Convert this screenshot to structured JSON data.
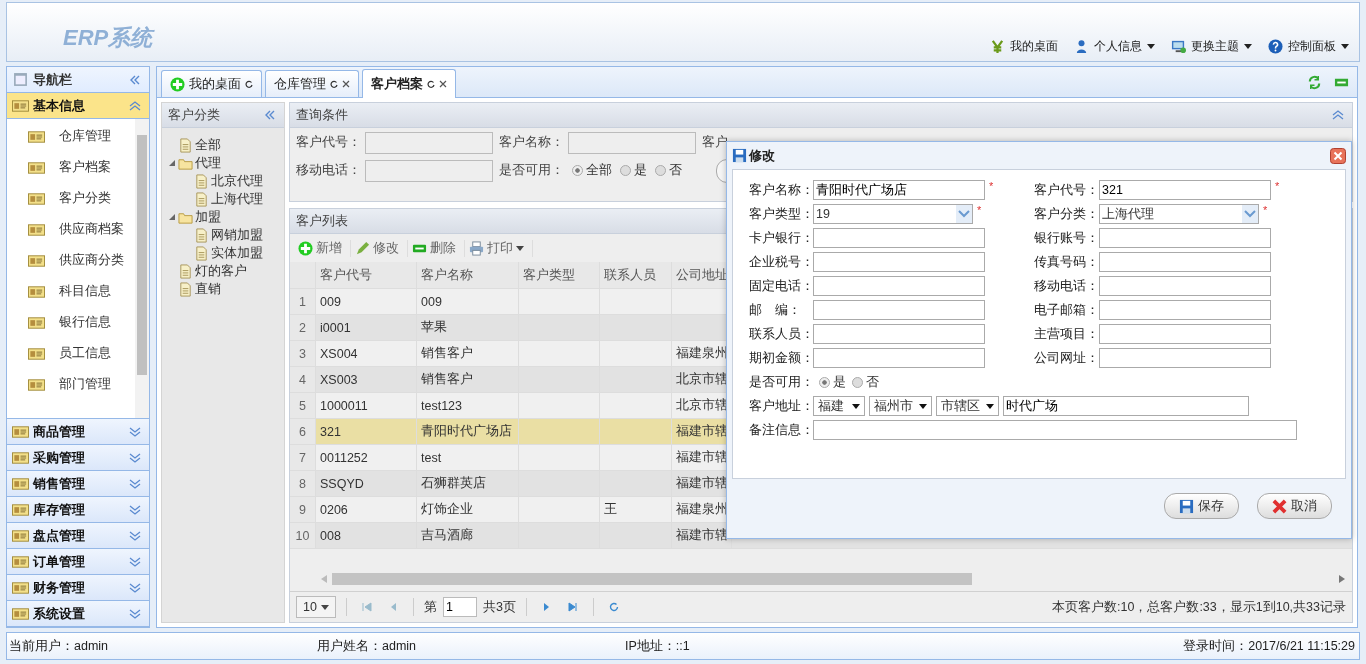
{
  "header": {
    "logo": "ERP系统",
    "menu": [
      {
        "label": "我的桌面",
        "kind": "money",
        "dropdown": false
      },
      {
        "label": "个人信息",
        "kind": "user",
        "dropdown": true
      },
      {
        "label": "更换主题",
        "kind": "monitor",
        "dropdown": true
      },
      {
        "label": "控制面板",
        "kind": "help",
        "dropdown": true
      }
    ]
  },
  "sidebar": {
    "title": "导航栏",
    "groups": [
      {
        "label": "基本信息",
        "expanded": true,
        "items": [
          "仓库管理",
          "客户档案",
          "客户分类",
          "供应商档案",
          "供应商分类",
          "科目信息",
          "银行信息",
          "员工信息",
          "部门管理"
        ]
      },
      {
        "label": "商品管理",
        "expanded": false
      },
      {
        "label": "采购管理",
        "expanded": false
      },
      {
        "label": "销售管理",
        "expanded": false
      },
      {
        "label": "库存管理",
        "expanded": false
      },
      {
        "label": "盘点管理",
        "expanded": false
      },
      {
        "label": "订单管理",
        "expanded": false
      },
      {
        "label": "财务管理",
        "expanded": false
      },
      {
        "label": "系统设置",
        "expanded": false
      }
    ]
  },
  "tabs": [
    {
      "label": "我的桌面",
      "selected": false,
      "closable": false,
      "kind": "home"
    },
    {
      "label": "仓库管理",
      "selected": false,
      "closable": true,
      "kind": "plain"
    },
    {
      "label": "客户档案",
      "selected": true,
      "closable": true,
      "kind": "plain"
    }
  ],
  "tree": {
    "title": "客户分类",
    "nodes": [
      {
        "label": "全部"
      },
      {
        "label": "代理",
        "expanded": true,
        "children": [
          {
            "label": "北京代理"
          },
          {
            "label": "上海代理"
          }
        ]
      },
      {
        "label": "加盟",
        "expanded": true,
        "children": [
          {
            "label": "网销加盟"
          },
          {
            "label": "实体加盟"
          }
        ]
      },
      {
        "label": "灯的客户"
      },
      {
        "label": "直销"
      }
    ]
  },
  "query": {
    "title": "查询条件",
    "fields": [
      {
        "label": "客户代号："
      },
      {
        "label": "客户名称："
      },
      {
        "label": "客户"
      }
    ],
    "mobile": {
      "label": "移动电话："
    },
    "enabled": {
      "label": "是否可用：",
      "options": [
        {
          "label": "全部",
          "selected": true
        },
        {
          "label": "是",
          "selected": false
        },
        {
          "label": "否",
          "selected": false
        }
      ]
    }
  },
  "list": {
    "title": "客户列表",
    "toolbar": [
      {
        "label": "新增",
        "kind": "add",
        "dropdown": false
      },
      {
        "label": "修改",
        "kind": "edit",
        "dropdown": false
      },
      {
        "label": "删除",
        "kind": "delete",
        "dropdown": false
      },
      {
        "label": "打印",
        "kind": "print",
        "dropdown": true
      }
    ],
    "columns": [
      "客户代号",
      "客户名称",
      "客户类型",
      "联系人员",
      "公司地址"
    ],
    "rows": [
      {
        "no": "1",
        "code": "009",
        "name": "009",
        "selected": false
      },
      {
        "no": "2",
        "code": "i0001",
        "name": "苹果",
        "selected": false
      },
      {
        "no": "3",
        "code": "XS004",
        "name": "销售客户",
        "address": "福建泉州",
        "selected": false
      },
      {
        "no": "4",
        "code": "XS003",
        "name": "销售客户",
        "address": "北京市辖",
        "selected": false
      },
      {
        "no": "5",
        "code": "1000011",
        "name": "test123",
        "address": "北京市辖",
        "selected": false
      },
      {
        "no": "6",
        "code": "321",
        "name": "青阳时代广场店",
        "address": "福建市辖",
        "selected": true
      },
      {
        "no": "7",
        "code": "0011252",
        "name": "test",
        "address": "福建市辖",
        "selected": false
      },
      {
        "no": "8",
        "code": "SSQYD",
        "name": "石狮群英店",
        "address": "福建市辖",
        "selected": false
      },
      {
        "no": "9",
        "code": "0206",
        "name": "灯饰企业",
        "contact": "王",
        "address": "福建泉州",
        "selected": false
      },
      {
        "no": "10",
        "code": "008",
        "name": "吉马酒廊",
        "address": "福建市辖",
        "selected": false
      }
    ],
    "pager": {
      "size": "10",
      "before": "第",
      "page": "1",
      "after": "共3页",
      "summary": "本页客户数:10，总客户数:33，显示1到10,共33记录"
    }
  },
  "dialog": {
    "title": "修改",
    "fields": [
      {
        "label": "客户名称：",
        "kind": "text",
        "value": "青阳时代广场店",
        "mark": "*"
      },
      {
        "label": "客户代号：",
        "kind": "text",
        "value": "321",
        "mark": "*"
      },
      {
        "label": "客户类型：",
        "kind": "combo",
        "value": "19",
        "mark": "*"
      },
      {
        "label": "客户分类：",
        "kind": "combo",
        "value": "上海代理",
        "mark": "*"
      },
      {
        "label": "卡户银行：",
        "kind": "text"
      },
      {
        "label": "银行账号：",
        "kind": "text"
      },
      {
        "label": "企业税号：",
        "kind": "text"
      },
      {
        "label": "传真号码：",
        "kind": "text"
      },
      {
        "label": "固定电话：",
        "kind": "text"
      },
      {
        "label": "移动电话：",
        "kind": "text"
      },
      {
        "label": "邮　编：",
        "kind": "text"
      },
      {
        "label": "电子邮箱：",
        "kind": "text"
      },
      {
        "label": "联系人员：",
        "kind": "text"
      },
      {
        "label": "主营项目：",
        "kind": "text"
      },
      {
        "label": "期初金额：",
        "kind": "text"
      },
      {
        "label": "公司网址：",
        "kind": "text"
      }
    ],
    "enabled": {
      "label": "是否可用：",
      "options": [
        {
          "label": "是",
          "selected": true
        },
        {
          "label": "否",
          "selected": false
        }
      ]
    },
    "address": {
      "label": "客户地址：",
      "selects": [
        "福建",
        "福州市",
        "市辖区"
      ],
      "value": "时代广场"
    },
    "remark": {
      "label": "备注信息："
    },
    "buttons": [
      {
        "label": "保存",
        "kind": "save"
      },
      {
        "label": "取消",
        "kind": "cancel"
      }
    ]
  },
  "status": [
    "当前用户：admin",
    "用户姓名：admin",
    "IP地址：::1",
    "登录时间：2017/6/21 11:15:29"
  ]
}
